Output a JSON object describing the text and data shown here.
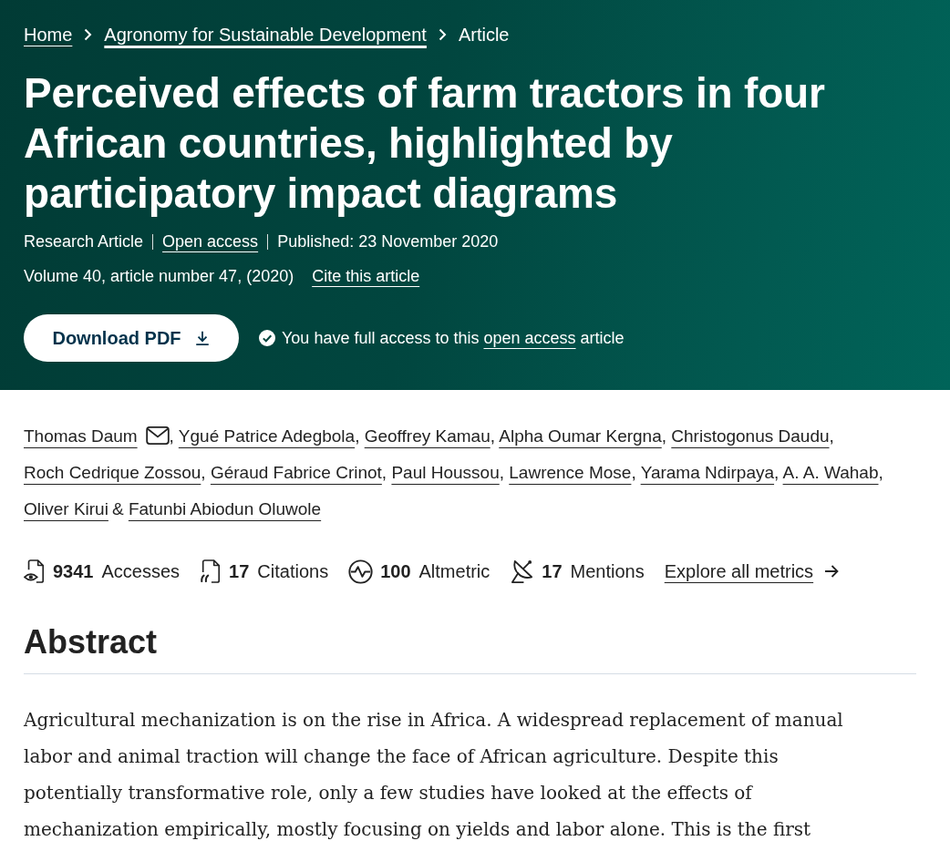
{
  "breadcrumbs": [
    {
      "kind": "link",
      "label": "Home",
      "focused": false
    },
    {
      "kind": "link",
      "label": "Agronomy for Sustainable Development",
      "focused": true
    },
    {
      "kind": "current",
      "label": "Article"
    }
  ],
  "article": {
    "title": "Perceived effects of farm tractors in four African countries, highlighted by participatory impact diagrams",
    "type": "Research Article",
    "access_link": "Open access",
    "published": "Published: 23 November 2020",
    "citation": "Volume 40, article number 47, (2020)",
    "cite_link": "Cite this article"
  },
  "download_button": {
    "label": "Download PDF"
  },
  "access_note": {
    "before": "You have full access to this",
    "link": "open access",
    "after": "article"
  },
  "authors": [
    {
      "name": "Thomas Daum",
      "email": true,
      "separator": ","
    },
    {
      "name": "Ygué Patrice Adegbola",
      "email": false,
      "separator": ","
    },
    {
      "name": "Geoffrey Kamau",
      "email": false,
      "separator": ","
    },
    {
      "name": "Alpha Oumar Kergna",
      "email": false,
      "separator": ","
    },
    {
      "name": "Christogonus Daudu",
      "email": false,
      "separator": ","
    },
    {
      "name": "Roch Cedrique Zossou",
      "email": false,
      "separator": ","
    },
    {
      "name": "Géraud Fabrice Crinot",
      "email": false,
      "separator": ","
    },
    {
      "name": "Paul Houssou",
      "email": false,
      "separator": ","
    },
    {
      "name": "Lawrence Mose",
      "email": false,
      "separator": ","
    },
    {
      "name": "Yarama Ndirpaya",
      "email": false,
      "separator": ","
    },
    {
      "name": "A. A. Wahab",
      "email": false,
      "separator": ","
    },
    {
      "name": "Oliver Kirui",
      "email": false,
      "separator": "&"
    },
    {
      "name": "Fatunbi Abiodun Oluwole",
      "email": false
    }
  ],
  "metrics": [
    {
      "kind": "accesses",
      "count": "9341",
      "label": "Accesses"
    },
    {
      "kind": "citations",
      "count": "17",
      "label": "Citations"
    },
    {
      "kind": "altmetric",
      "count": "100",
      "label": "Altmetric"
    },
    {
      "kind": "mentions",
      "count": "17",
      "label": "Mentions"
    }
  ],
  "explore_link": "Explore all metrics",
  "abstract": {
    "heading": "Abstract",
    "text": "Agricultural mechanization is on the rise in Africa. A widespread replacement of manual labor and animal traction will change the face of African agriculture. Despite this potentially transformative role, only a few studies have looked at the effects of mechanization empirically, mostly focusing on yields and labor alone. This is the first"
  }
}
